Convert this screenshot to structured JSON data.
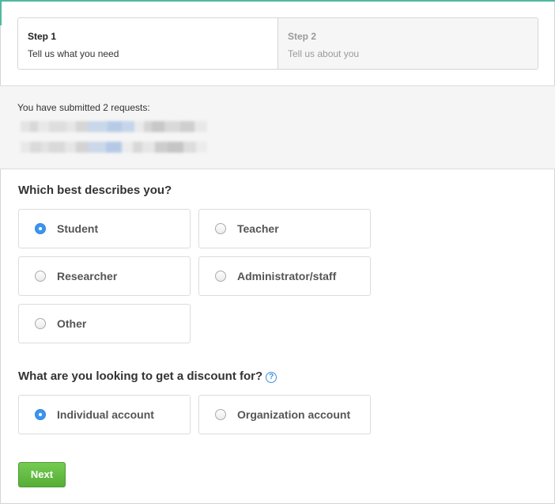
{
  "colors": {
    "accent": "#4fb99f",
    "radio_selected": "#3b95ef",
    "next_button": "#5cb43d",
    "help_icon": "#3b8fd8"
  },
  "steps": [
    {
      "number": "Step 1",
      "description": "Tell us what you need",
      "state": "active"
    },
    {
      "number": "Step 2",
      "description": "Tell us about you",
      "state": "inactive"
    }
  ],
  "requests": {
    "title": "You have submitted 2 requests:"
  },
  "describe": {
    "question": "Which best describes you?",
    "selected": "Student",
    "options": [
      {
        "label": "Student",
        "checked": true
      },
      {
        "label": "Teacher",
        "checked": false
      },
      {
        "label": "Researcher",
        "checked": false
      },
      {
        "label": "Administrator/staff",
        "checked": false
      },
      {
        "label": "Other",
        "checked": false
      }
    ]
  },
  "discount": {
    "question": "What are you looking to get a discount for?",
    "help_icon": "question-circle-icon",
    "selected": "Individual account",
    "options": [
      {
        "label": "Individual account",
        "checked": true
      },
      {
        "label": "Organization account",
        "checked": false
      }
    ]
  },
  "next_button": {
    "label": "Next"
  }
}
